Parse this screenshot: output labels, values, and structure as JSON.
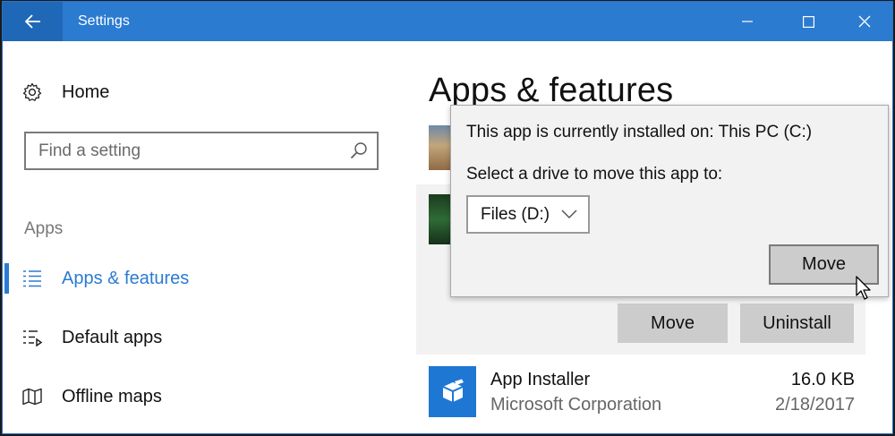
{
  "window": {
    "title": "Settings",
    "icons": {
      "back": "arrow-left-icon",
      "minimize": "minimize-icon",
      "maximize": "maximize-icon",
      "close": "close-icon"
    }
  },
  "sidebar": {
    "home_label": "Home",
    "search_placeholder": "Find a setting",
    "section_label": "Apps",
    "items": [
      {
        "label": "Apps & features",
        "icon": "list-icon",
        "active": true
      },
      {
        "label": "Default apps",
        "icon": "default-apps-icon",
        "active": false
      },
      {
        "label": "Offline maps",
        "icon": "map-icon",
        "active": false
      }
    ]
  },
  "main": {
    "title": "Apps & features",
    "selected_actions": {
      "move_label": "Move",
      "uninstall_label": "Uninstall"
    },
    "apps": [
      {
        "name": "App Installer",
        "publisher": "Microsoft Corporation",
        "size": "16.0 KB",
        "date": "2/18/2017",
        "icon": "package-icon"
      }
    ]
  },
  "move_popup": {
    "installed_on_text": "This app is currently installed on: This PC (C:)",
    "select_drive_text": "Select a drive to move this app to:",
    "selected_drive": "Files (D:)",
    "move_label": "Move"
  },
  "colors": {
    "accent": "#2b7bd1",
    "title_bar": "#2b7bd1",
    "back_button": "#1f68b7",
    "button_gray": "#cccccc"
  }
}
